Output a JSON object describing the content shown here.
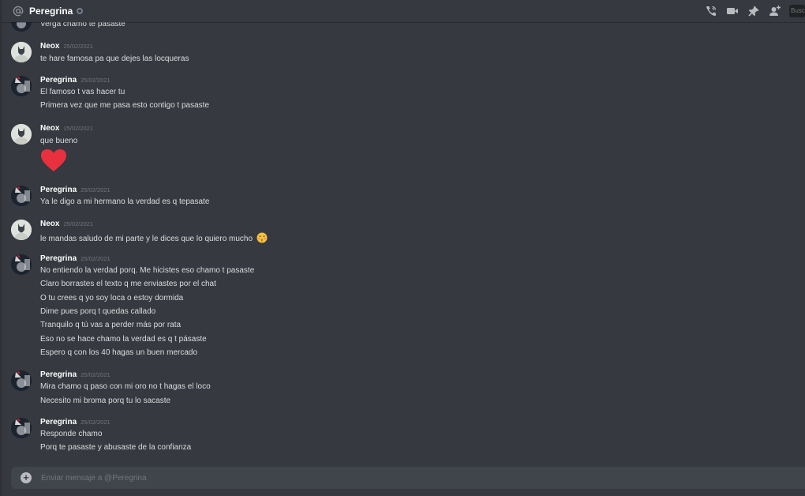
{
  "header": {
    "title": "Peregrina",
    "search_label": "Buscar"
  },
  "composer": {
    "placeholder": "Enviar mensaje a @Peregrina"
  },
  "messages": {
    "partial": {
      "line": "Verga chamo te pasaste"
    },
    "g1": {
      "author": "Neox",
      "time": "25/02/2021",
      "lines": [
        "te hare famosa pa que dejes las locqueras"
      ]
    },
    "g2": {
      "author": "Peregrina",
      "time": "25/02/2021",
      "lines": [
        "El famoso t vas hacer tu",
        "Primera vez que me pasa esto contigo t pasaste"
      ]
    },
    "g3": {
      "author": "Neox",
      "time": "25/02/2021",
      "lines": [
        "que bueno"
      ]
    },
    "g4": {
      "author": "Peregrina",
      "time": "25/02/2021",
      "lines": [
        "Ya le digo a mi hermano la verdad es q tepasate"
      ]
    },
    "g5": {
      "author": "Neox",
      "time": "25/02/2021",
      "lines": [
        "le mandas saludo de mi parte y le dices que lo quiero mucho"
      ]
    },
    "g6": {
      "author": "Peregrina",
      "time": "25/02/2021",
      "lines": [
        "No entiendo la verdad porq. Me hicistes eso chamo t pasaste",
        "Claro borrastes el texto q me enviastes por el chat",
        "O tu crees q yo soy loca o estoy dormida",
        "Dime pues porq t quedas callado",
        "Tranquilo q tú vas a perder  más por rata",
        "Eso no se hace chamo la verdad es q t pásaste",
        "Espero q con los 40 hagas un buen mercado"
      ]
    },
    "g7": {
      "author": "Peregrina",
      "time": "25/02/2021",
      "lines": [
        "Mira chamo q paso con mi oro no t hagas el loco",
        "Necesito mi broma porq tu lo sacaste"
      ]
    },
    "g8": {
      "author": "Peregrina",
      "time": "25/02/2021",
      "lines": [
        "Responde chamo",
        "Porq te pasaste y abusaste de la confianza"
      ]
    }
  },
  "colors": {
    "background": "#36393f",
    "composer": "#40444b",
    "heart": "#e8303f"
  },
  "icons": [
    "at-icon",
    "call-icon",
    "video-icon",
    "pin-icon",
    "add-friend-icon",
    "add-attachment-icon",
    "heart-emoji-icon",
    "kiss-emoji-icon"
  ]
}
